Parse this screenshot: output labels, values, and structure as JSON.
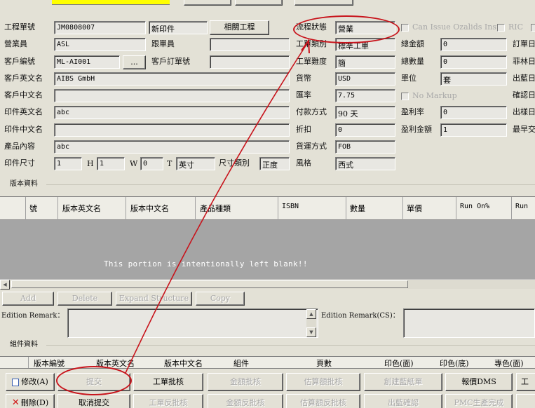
{
  "top": {
    "yellow_field_value": ""
  },
  "form": {
    "job_no_label": "工程單號",
    "job_no_value": "JM0808007",
    "print_type_value": "新印件",
    "related_job_button": "相關工程",
    "sales_label": "營業員",
    "sales_value": "ASL",
    "follower_label": "跟單員",
    "follower_value": "",
    "customer_code_label": "客戶編號",
    "customer_code_value": "ML-AI001",
    "customer_code_lookup": "...",
    "customer_po_label": "客戶訂單號",
    "customer_po_value": "",
    "customer_en_label": "客戶英文名",
    "customer_en_value": "AIBS GmbH",
    "customer_cn_label": "客戶中文名",
    "customer_cn_value": "",
    "item_en_label": "印件英文名",
    "item_en_value": "abc",
    "item_cn_label": "印件中文名",
    "item_cn_value": "",
    "product_content_label": "產品內容",
    "product_content_value": "abc",
    "print_size_label": "印件尺寸",
    "size_l_value": "1",
    "size_h_label": "H",
    "size_h_value": "1",
    "size_w_label": "W",
    "size_w_value": "0",
    "size_t_label": "T",
    "size_unit_value": "英寸",
    "size_category_label": "尺寸類別",
    "size_category_value": "正度",
    "workflow_status_label": "流程狀態",
    "workflow_status_value": "營業",
    "job_category_label": "工單類別",
    "job_category_value": "標準工單",
    "job_difficulty_label": "工單難度",
    "job_difficulty_value": "簡",
    "currency_label": "貨幣",
    "currency_value": "USD",
    "exchange_rate_label": "匯率",
    "exchange_rate_value": "7.75",
    "payment_terms_label": "付款方式",
    "payment_terms_value": "90 天",
    "discount_label": "折扣",
    "discount_value": "0",
    "shipping_terms_label": "貨運方式",
    "shipping_terms_value": "FOB",
    "style_label": "風格",
    "style_value": "西式",
    "can_issue_label": "Can Issue Ozalids Instr",
    "ric_label": "RIC",
    "total_amount_label": "總金額",
    "total_amount_value": "0",
    "total_qty_label": "總數量",
    "total_qty_value": "0",
    "unit_label": "單位",
    "unit_value": "套",
    "no_markup_label": "No Markup",
    "profit_rate_label": "盈利率",
    "profit_rate_value": "0",
    "profit_amount_label": "盈利金額",
    "profit_amount_value": "1",
    "right_edge_labels": [
      "訂單日",
      "菲林日",
      "出藍日",
      "確認日",
      "出樣日",
      "最早交"
    ]
  },
  "editions": {
    "section_label": "版本資料",
    "columns": [
      "號",
      "版本英文名",
      "版本中文名",
      "產品種類",
      "ISBN",
      "數量",
      "單價",
      "Run On%",
      "Run"
    ],
    "blank_message": "This portion is intentionally left blank!!",
    "buttons": {
      "add": "Add",
      "delete": "Delete",
      "expand": "Expand Structure",
      "copy": "Copy"
    },
    "remark_label": "Edition Remark：",
    "remark_cs_label": "Edition Remark(CS)："
  },
  "components": {
    "section_label": "組件資料",
    "columns": [
      "版本編號",
      "版本英文名",
      "版本中文名",
      "組件",
      "頁數",
      "印色(面)",
      "印色(底)",
      "專色(面)"
    ]
  },
  "actions": {
    "modify": "修改(A)",
    "submit": "提交",
    "job_approve": "工單批核",
    "amount_approve": "金額批核",
    "estimate_approve": "估算額批核",
    "create_blue": "創建藍紙單",
    "quote_dms": "報價DMS",
    "edge_button": "工",
    "delete": "刪除(D)",
    "cancel_submit": "取消提交",
    "job_reverse": "工單反批核",
    "amount_reverse": "金額反批核",
    "estimate_reverse": "估算額反批核",
    "blue_confirm": "出藍確認",
    "pmc_complete": "PMC生產完成"
  },
  "colors": {
    "annotation": "#c8141c",
    "grid_blank": "#a5a5a5",
    "window_bg": "#e3e1d6",
    "yellow": "#ffff00"
  }
}
